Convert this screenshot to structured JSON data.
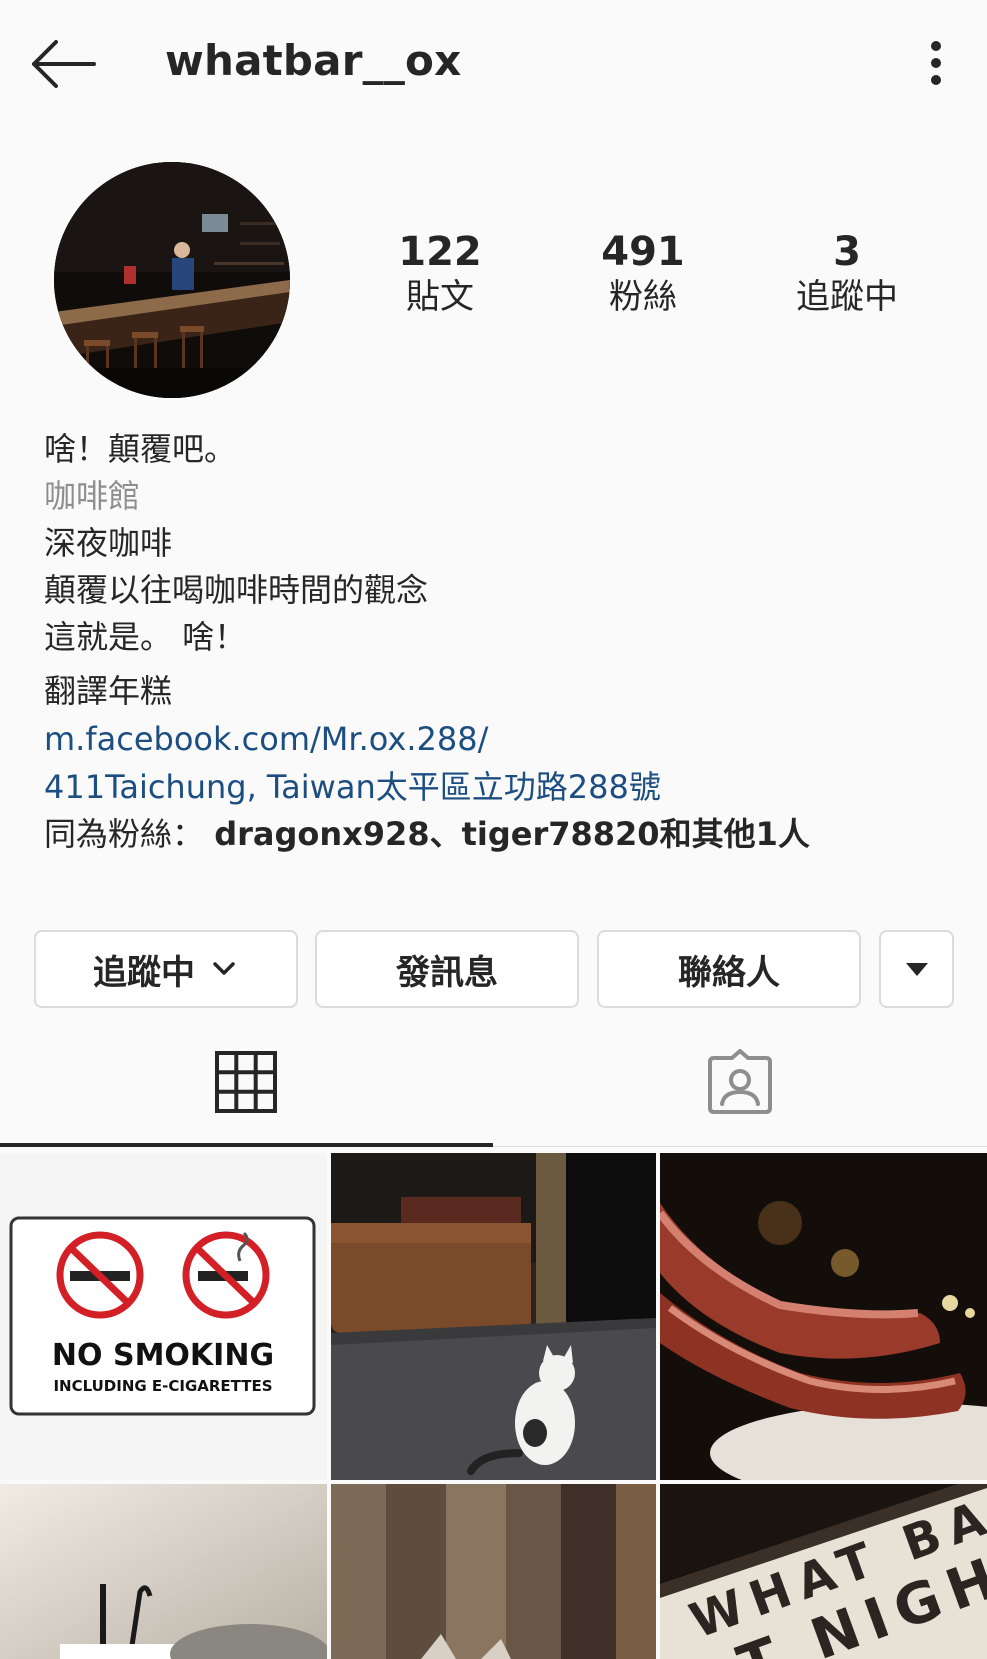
{
  "header": {
    "username": "whatbar__ox",
    "back_icon": "arrow-left-icon",
    "more_icon": "more-vertical-icon"
  },
  "stats": [
    {
      "count": "122",
      "label": "貼文"
    },
    {
      "count": "491",
      "label": "粉絲"
    },
    {
      "count": "3",
      "label": "追蹤中"
    }
  ],
  "bio": {
    "name": "啥！顛覆吧。",
    "category": "咖啡館",
    "lines": [
      "深夜咖啡",
      "顛覆以往喝咖啡時間的觀念",
      "這就是。 啥！"
    ],
    "translate": "翻譯年糕",
    "website": "m.facebook.com/Mr.ox.288/",
    "address": "411Taichung, Taiwan太平區立功路288號",
    "mutual_prefix": "同為粉絲：",
    "mutual_names": "dragonx928、tiger78820",
    "mutual_suffix": "和其他1人"
  },
  "actions": {
    "following": "追蹤中",
    "message": "發訊息",
    "contact": "聯絡人"
  },
  "tabs": {
    "grid_icon": "grid-icon",
    "tagged_icon": "tagged-person-icon"
  },
  "posts": {
    "no_smoking_title": "NO SMOKING",
    "no_smoking_sub": "INCLUDING E-CIGARETTES",
    "lightbox_line1": "WHAT BA",
    "lightbox_line2": "T NIGHT"
  },
  "colors": {
    "text": "#262626",
    "secondary": "#8e8e8e",
    "link": "#1c4e82",
    "border": "#dbdbdb",
    "no_smoking_red": "#d32027"
  }
}
